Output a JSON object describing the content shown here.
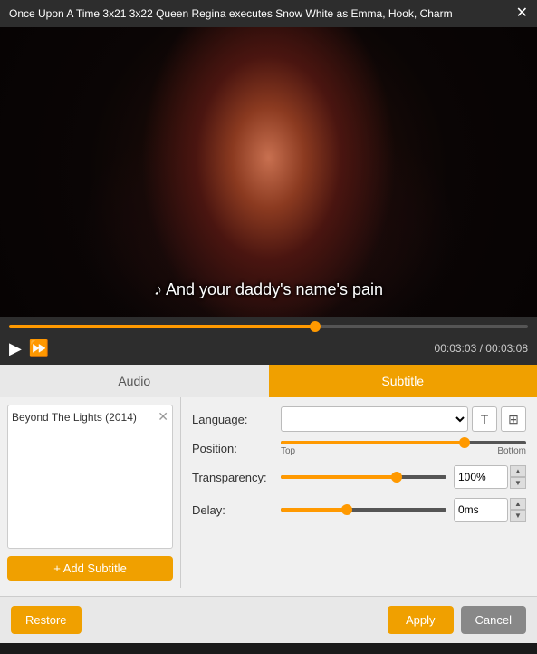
{
  "titleBar": {
    "title": "Once Upon A Time 3x21 3x22 Queen Regina executes Snow White as Emma, Hook, Charm",
    "closeLabel": "✕"
  },
  "video": {
    "subtitle": "♪  And your daddy's name's pain"
  },
  "controls": {
    "playIcon": "▶",
    "ffIcon": "⏩",
    "currentTime": "00:03:03",
    "separator": "/",
    "totalTime": "00:03:08",
    "progressPercent": 59
  },
  "tabs": [
    {
      "id": "audio",
      "label": "Audio",
      "active": false
    },
    {
      "id": "subtitle",
      "label": "Subtitle",
      "active": true
    }
  ],
  "subtitlePanel": {
    "subtitleItem": {
      "name": "Beyond The Lights (2014)",
      "removeLabel": "✕"
    },
    "addButtonLabel": "+ Add Subtitle"
  },
  "subtitleSettings": {
    "languageLabel": "Language:",
    "languagePlaceholder": "",
    "langOptions": [
      ""
    ],
    "textIconLabel": "T",
    "ccIconLabel": "⊞",
    "positionLabel": "Position:",
    "positionTopLabel": "Top",
    "positionBottomLabel": "Bottom",
    "positionPercent": 75,
    "transparencyLabel": "Transparency:",
    "transparencyValue": "100%",
    "transparencyPercent": 70,
    "delayLabel": "Delay:",
    "delayValue": "0ms",
    "delayPercent": 40
  },
  "footer": {
    "restoreLabel": "Restore",
    "applyLabel": "Apply",
    "cancelLabel": "Cancel"
  }
}
